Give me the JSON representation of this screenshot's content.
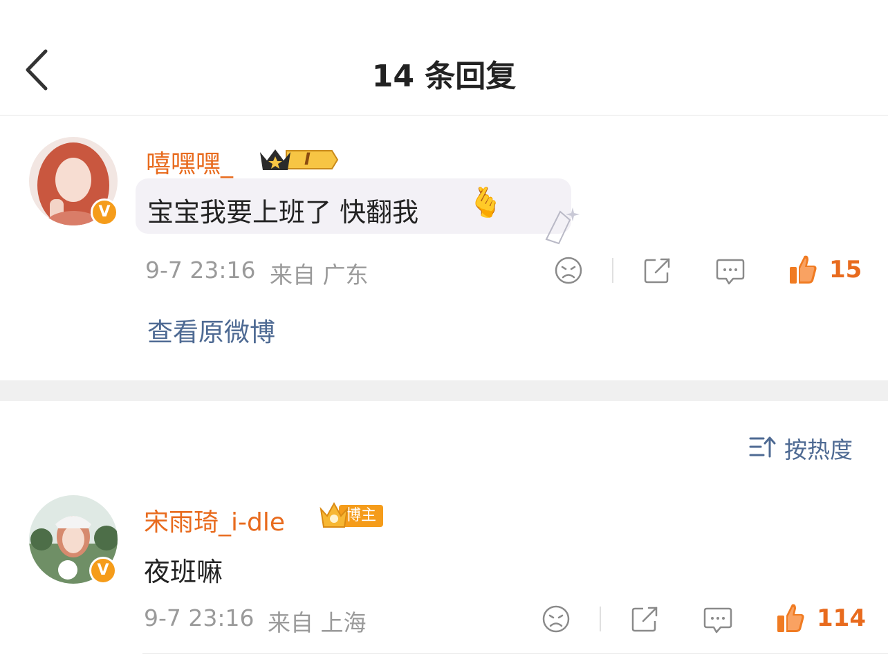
{
  "header": {
    "title": "14 条回复"
  },
  "original_comment": {
    "username": "嘻嘿嘿_",
    "level_badge": "I",
    "text": "宝宝我要上班了 快翻我",
    "emoji": "🫰",
    "time": "9-7 23:16",
    "from": "来自 广东",
    "likes": "15",
    "view_original": "查看原微博"
  },
  "sort": {
    "label": "按热度"
  },
  "replies": [
    {
      "username": "宋雨琦_i-dle",
      "badge": "博主",
      "text": "夜班嘛",
      "time": "9-7 23:16",
      "from": "来自 上海",
      "likes": "114"
    }
  ],
  "colors": {
    "accent": "#e86b1e",
    "link": "#4e6a93",
    "muted": "#9a9a9a"
  }
}
